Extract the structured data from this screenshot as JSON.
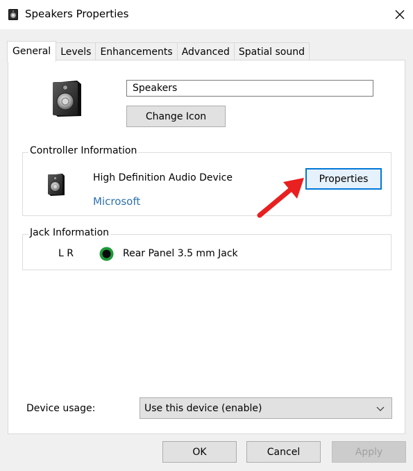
{
  "window": {
    "title": "Speakers Properties"
  },
  "tabs": [
    {
      "label": "General",
      "active": true
    },
    {
      "label": "Levels",
      "active": false
    },
    {
      "label": "Enhancements",
      "active": false
    },
    {
      "label": "Advanced",
      "active": false
    },
    {
      "label": "Spatial sound",
      "active": false
    }
  ],
  "general": {
    "device_name_value": "Speakers",
    "change_icon_label": "Change Icon",
    "controller": {
      "group_label": "Controller Information",
      "device": "High Definition Audio Device",
      "vendor": "Microsoft",
      "properties_label": "Properties"
    },
    "jack": {
      "group_label": "Jack Information",
      "channels": "L R",
      "jack_color": "#1f9a3a",
      "description": "Rear Panel 3.5 mm Jack"
    },
    "device_usage": {
      "label": "Device usage:",
      "selected": "Use this device (enable)"
    }
  },
  "footer": {
    "ok_label": "OK",
    "cancel_label": "Cancel",
    "apply_label": "Apply"
  },
  "icons": {
    "title": "speaker-icon",
    "close": "close-icon",
    "device": "speaker-icon",
    "jack": "audio-jack-icon",
    "chevron": "chevron-down-icon",
    "annotation": "red-arrow-icon"
  },
  "colors": {
    "accent": "#0078d7",
    "link": "#2f71b3",
    "annotation_arrow": "#e8201f"
  }
}
